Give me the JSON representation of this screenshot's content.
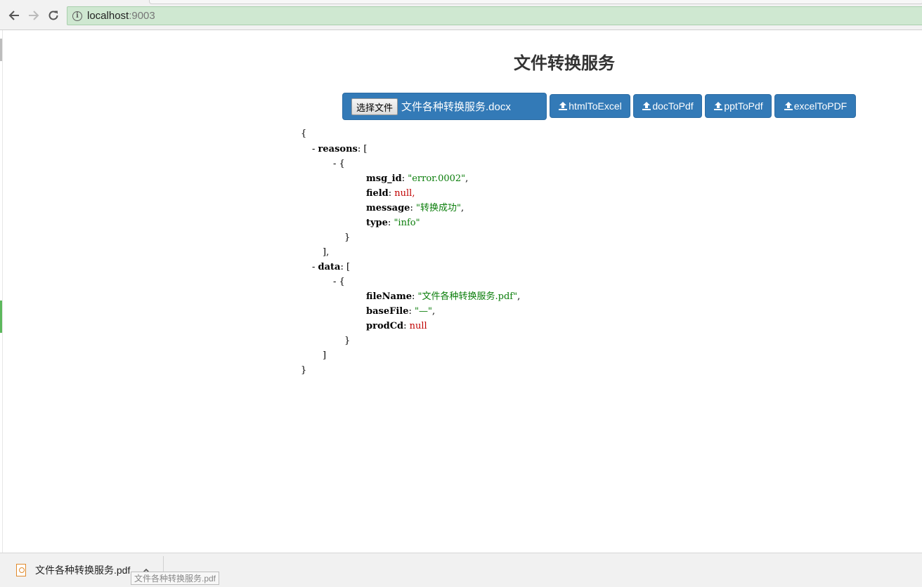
{
  "browser": {
    "url_host": "localhost",
    "url_port": ":9003"
  },
  "page": {
    "title": "文件转换服务",
    "file_input": {
      "button_label": "选择文件",
      "selected_file": "文件各种转换服务.docx"
    },
    "buttons": [
      {
        "label": "htmlToExcel",
        "icon": "upload-icon"
      },
      {
        "label": "docToPdf",
        "icon": "upload-icon"
      },
      {
        "label": "pptToPdf",
        "icon": "upload-icon"
      },
      {
        "label": "excelToPDF",
        "icon": "upload-icon"
      }
    ]
  },
  "json_view": {
    "lines": {
      "l0": "{",
      "l1_dash": "- ",
      "l1_key": "reasons",
      "l1_rest": ": [",
      "l2": "- {",
      "l3_key": "msg_id",
      "l3_val": "\"error.0002\"",
      "l3_end": ",",
      "l4_key": "field",
      "l4_val": "null",
      "l4_end": ",",
      "l5_key": "message",
      "l5_val": "\"转换成功\"",
      "l5_end": ",",
      "l6_key": "type",
      "l6_val": "\"info\"",
      "l7": "}",
      "l8": "],",
      "l9_dash": "- ",
      "l9_key": "data",
      "l9_rest": ": [",
      "l10": "- {",
      "l11_key": "fileName",
      "l11_val": "\"文件各种转换服务.pdf\"",
      "l11_end": ",",
      "l12_key": "baseFile",
      "l12_val": "\"—\"",
      "l12_end": ",",
      "l13_key": "prodCd",
      "l13_val": "null",
      "l14": "}",
      "l15": "]",
      "l16": "}"
    },
    "colors": {
      "string": "#0a7d0a",
      "null": "#c00000"
    }
  },
  "download_bar": {
    "file_name": "文件各种转换服务.pdf",
    "tooltip": "文件各种转换服务.pdf"
  },
  "colors": {
    "primary": "#337ab7",
    "omnibox_secure": "#cfe8d1"
  }
}
